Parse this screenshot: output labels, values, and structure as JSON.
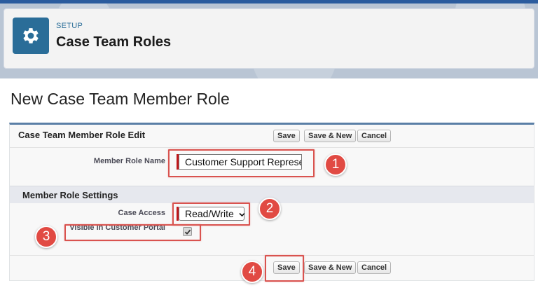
{
  "header": {
    "eyebrow": "SETUP",
    "title": "Case Team Roles",
    "icon": "gear-icon"
  },
  "page": {
    "title": "New Case Team Member Role"
  },
  "form": {
    "section_title": "Case Team Member Role Edit",
    "buttons": {
      "save": "Save",
      "save_new": "Save & New",
      "cancel": "Cancel"
    },
    "member_role_name": {
      "label": "Member Role Name",
      "value": "Customer Support Represe"
    },
    "settings_title": "Member Role Settings",
    "case_access": {
      "label": "Case Access",
      "value": "Read/Write"
    },
    "portal_visible": {
      "label": "Visible in Customer Portal",
      "checked": true
    }
  },
  "annotations": [
    "1",
    "2",
    "3",
    "4"
  ],
  "colors": {
    "accent": "#2a6d98",
    "highlight": "#d9534f",
    "badge": "#e14a43",
    "required": "#c0161a"
  }
}
